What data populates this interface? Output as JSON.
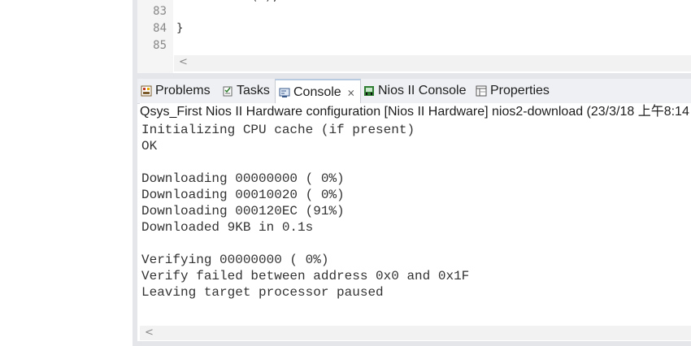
{
  "editor": {
    "line_numbers": [
      "83",
      "84",
      "85"
    ],
    "lines": [
      "",
      "}",
      ""
    ],
    "partial_top": "(  );"
  },
  "tabs": [
    {
      "label": "Problems",
      "icon": "problems-icon"
    },
    {
      "label": "Tasks",
      "icon": "tasks-icon"
    },
    {
      "label": "Console",
      "icon": "console-icon",
      "close": "⨯"
    },
    {
      "label": "Nios II Console",
      "icon": "nios-console-icon"
    },
    {
      "label": "Properties",
      "icon": "properties-icon"
    }
  ],
  "console": {
    "title": "Qsys_First Nios II Hardware configuration [Nios II Hardware] nios2-download (23/3/18 上午8:14",
    "lines": [
      "Initializing CPU cache (if present)",
      "OK",
      "",
      "Downloading 00000000 ( 0%)",
      "Downloading 00010020 ( 0%)",
      "Downloading 000120EC (91%)",
      "Downloaded 9KB in 0.1s",
      "",
      "Verifying 00000000 ( 0%)",
      "Verify failed between address 0x0 and 0x1F",
      "Leaving target processor paused"
    ]
  },
  "scroll_arrow": "<"
}
